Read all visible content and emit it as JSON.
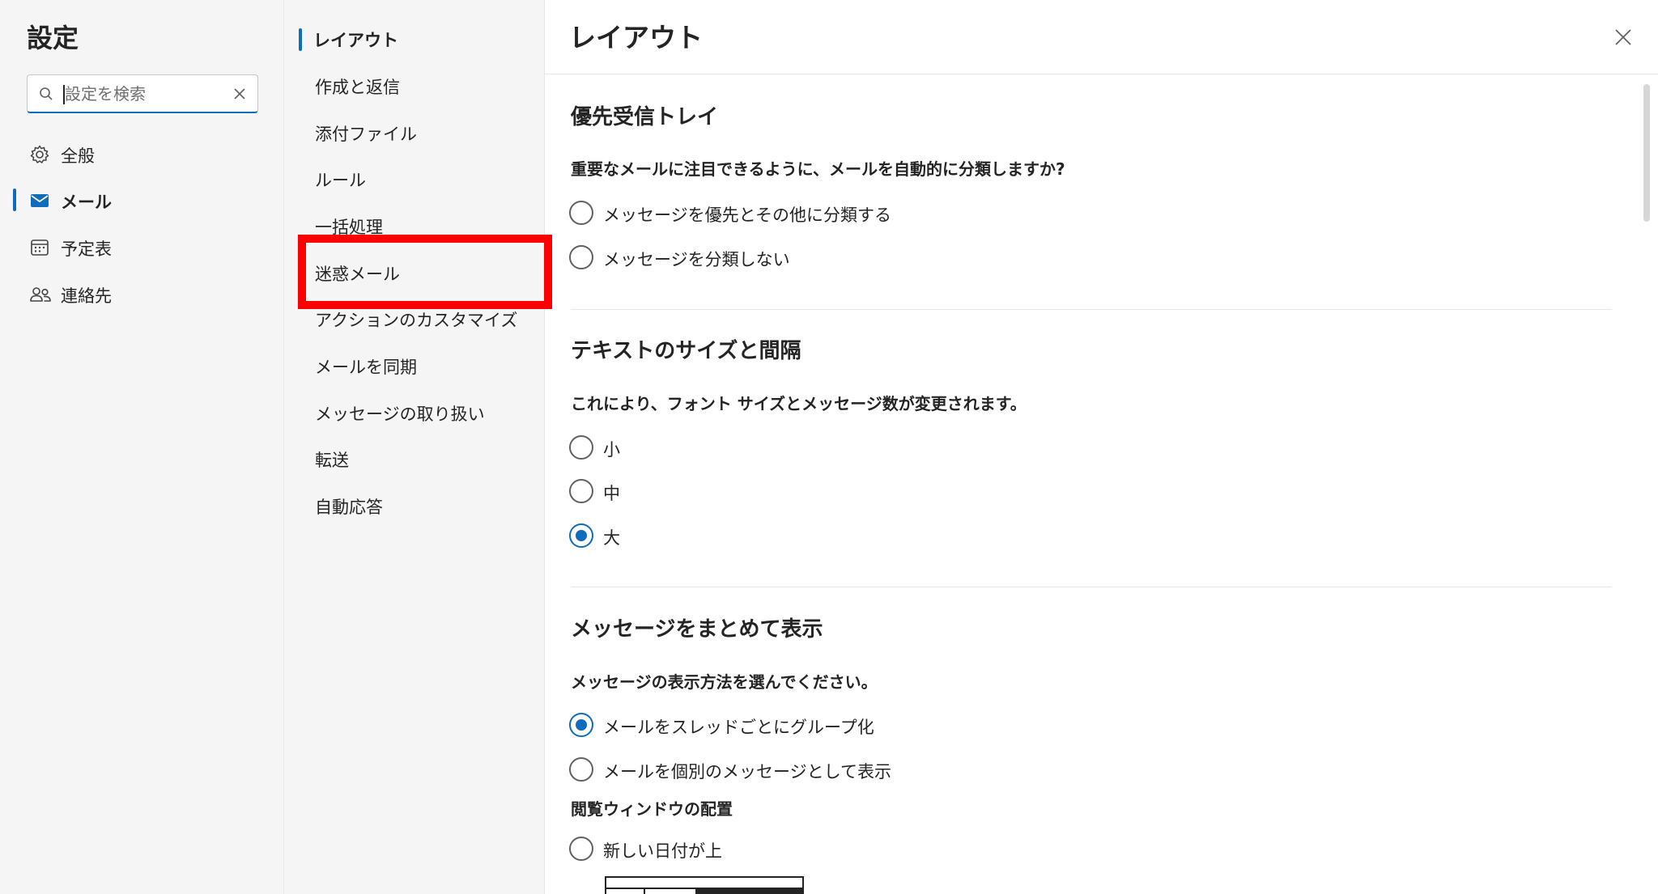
{
  "settings": {
    "title": "設定",
    "search": {
      "placeholder": "設定を検索",
      "value": ""
    }
  },
  "nav": {
    "items": [
      {
        "label": "全般",
        "icon": "gear-icon"
      },
      {
        "label": "メール",
        "icon": "mail-icon",
        "active": true
      },
      {
        "label": "予定表",
        "icon": "calendar-icon"
      },
      {
        "label": "連絡先",
        "icon": "people-icon"
      }
    ]
  },
  "submenu": {
    "items": [
      {
        "label": "レイアウト",
        "active": true
      },
      {
        "label": "作成と返信"
      },
      {
        "label": "添付ファイル"
      },
      {
        "label": "ルール"
      },
      {
        "label": "一括処理"
      },
      {
        "label": "迷惑メール",
        "highlighted": true
      },
      {
        "label": "アクションのカスタマイズ"
      },
      {
        "label": "メールを同期"
      },
      {
        "label": "メッセージの取り扱い"
      },
      {
        "label": "転送"
      },
      {
        "label": "自動応答"
      }
    ]
  },
  "panel": {
    "title": "レイアウト",
    "focused_inbox": {
      "title": "優先受信トレイ",
      "desc": "重要なメールに注目できるように、メールを自動的に分類しますか?",
      "options": [
        {
          "label": "メッセージを優先とその他に分類する",
          "checked": false
        },
        {
          "label": "メッセージを分類しない",
          "checked": false
        }
      ]
    },
    "text_size": {
      "title": "テキストのサイズと間隔",
      "desc": "これにより、フォント サイズとメッセージ数が変更されます。",
      "options": [
        {
          "label": "小",
          "checked": false
        },
        {
          "label": "中",
          "checked": false
        },
        {
          "label": "大",
          "checked": true
        }
      ]
    },
    "conversation": {
      "title": "メッセージをまとめて表示",
      "desc": "メッセージの表示方法を選んでください。",
      "options": [
        {
          "label": "メールをスレッドごとにグループ化",
          "checked": true
        },
        {
          "label": "メールを個別のメッセージとして表示",
          "checked": false
        }
      ],
      "reading_pane_heading": "閲覧ウィンドウの配置",
      "reading_options": [
        {
          "label": "新しい日付が上",
          "checked": false
        }
      ]
    }
  },
  "colors": {
    "accent": "#0f6cbd",
    "highlight": "#ff0000",
    "sidebar_bg": "#f5f5f5"
  }
}
